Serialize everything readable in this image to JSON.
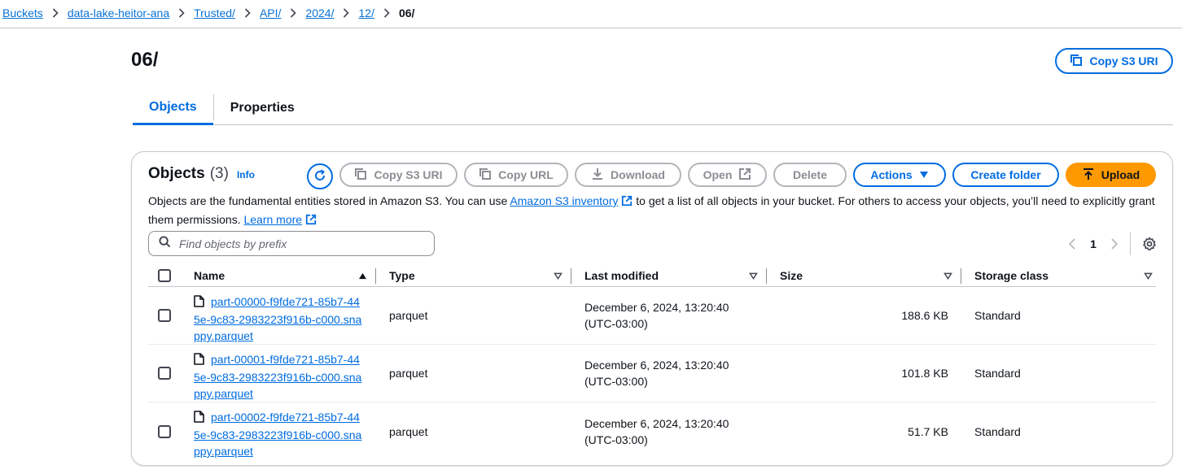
{
  "breadcrumb": {
    "items": [
      "Buckets",
      "data-lake-heitor-ana",
      "Trusted/",
      "API/",
      "2024/",
      "12/"
    ],
    "current": "06/"
  },
  "header": {
    "title": "06/",
    "copy_s3_uri": "Copy S3 URI"
  },
  "tabs": [
    {
      "label": "Objects",
      "active": true
    },
    {
      "label": "Properties",
      "active": false
    }
  ],
  "objects_panel": {
    "title": "Objects",
    "count": "(3)",
    "info": "Info",
    "toolbar": {
      "copy_s3_uri": "Copy S3 URI",
      "copy_url": "Copy URL",
      "download": "Download",
      "open": "Open",
      "delete": "Delete",
      "actions": "Actions",
      "create_folder": "Create folder",
      "upload": "Upload"
    },
    "description": {
      "part1": "Objects are the fundamental entities stored in Amazon S3. You can use ",
      "link1": "Amazon S3 inventory",
      "part2": " to get a list of all objects in your bucket. For others to access your objects, you’ll need to explicitly grant them permissions. ",
      "link2": "Learn more"
    },
    "search": {
      "placeholder": "Find objects by prefix",
      "value": ""
    },
    "pagination": {
      "current_page": "1"
    },
    "columns": [
      "Name",
      "Type",
      "Last modified",
      "Size",
      "Storage class"
    ],
    "rows": [
      {
        "name": "part-00000-f9fde721-85b7-445e-9c83-2983223f916b-c000.snappy.parquet",
        "type": "parquet",
        "modified_date": "December 6, 2024, 13:20:40",
        "modified_tz": "(UTC-03:00)",
        "size": "188.6 KB",
        "storage": "Standard"
      },
      {
        "name": "part-00001-f9fde721-85b7-445e-9c83-2983223f916b-c000.snappy.parquet",
        "type": "parquet",
        "modified_date": "December 6, 2024, 13:20:40",
        "modified_tz": "(UTC-03:00)",
        "size": "101.8 KB",
        "storage": "Standard"
      },
      {
        "name": "part-00002-f9fde721-85b7-445e-9c83-2983223f916b-c000.snappy.parquet",
        "type": "parquet",
        "modified_date": "December 6, 2024, 13:20:40",
        "modified_tz": "(UTC-03:00)",
        "size": "51.7 KB",
        "storage": "Standard"
      }
    ]
  },
  "colors": {
    "link": "#0972d3",
    "primary_button": "#ff9900",
    "accent": "#006ce0",
    "disabled": "#8c8c94"
  },
  "icons": [
    "copy-icon",
    "refresh-icon",
    "download-icon",
    "external-link-icon",
    "caret-down-icon",
    "upload-icon",
    "search-icon",
    "chevron-left-icon",
    "chevron-right-icon",
    "gear-icon",
    "file-icon",
    "sort-ascending-icon",
    "sort-descending-icon"
  ]
}
